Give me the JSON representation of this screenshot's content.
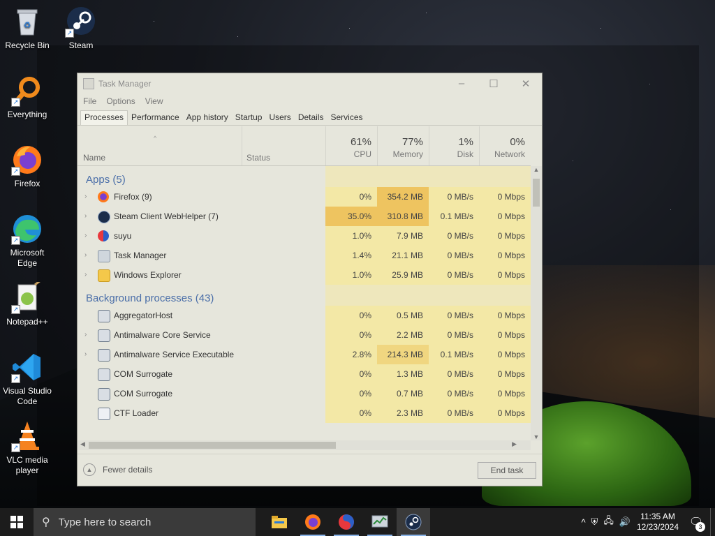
{
  "desktop": {
    "icons": [
      {
        "label": "Recycle Bin",
        "icon": "recycle-bin-icon"
      },
      {
        "label": "Steam",
        "icon": "steam-icon"
      },
      {
        "label": "Everything",
        "icon": "everything-icon"
      },
      {
        "label": "Firefox",
        "icon": "firefox-icon"
      },
      {
        "label": "Microsoft Edge",
        "icon": "edge-icon"
      },
      {
        "label": "Notepad++",
        "icon": "notepadpp-icon"
      },
      {
        "label": "Visual Studio Code",
        "icon": "vscode-icon"
      },
      {
        "label": "VLC media player",
        "icon": "vlc-icon"
      }
    ]
  },
  "task_manager": {
    "title": "Task Manager",
    "menu": [
      "File",
      "Options",
      "View"
    ],
    "tabs": [
      "Processes",
      "Performance",
      "App history",
      "Startup",
      "Users",
      "Details",
      "Services"
    ],
    "active_tab": "Processes",
    "columns": {
      "name": "Name",
      "status": "Status",
      "cpu": {
        "pct": "61%",
        "label": "CPU"
      },
      "memory": {
        "pct": "77%",
        "label": "Memory"
      },
      "disk": {
        "pct": "1%",
        "label": "Disk"
      },
      "network": {
        "pct": "0%",
        "label": "Network"
      }
    },
    "groups": [
      {
        "title": "Apps (5)",
        "rows": [
          {
            "name": "Firefox (9)",
            "cpu": "0%",
            "memory": "354.2 MB",
            "disk": "0 MB/s",
            "network": "0 Mbps",
            "expandable": true,
            "icon": "firefox-icon"
          },
          {
            "name": "Steam Client WebHelper (7)",
            "cpu": "35.0%",
            "memory": "310.8 MB",
            "disk": "0.1 MB/s",
            "network": "0 Mbps",
            "expandable": true,
            "icon": "steam-icon"
          },
          {
            "name": "suyu",
            "cpu": "1.0%",
            "memory": "7.9 MB",
            "disk": "0 MB/s",
            "network": "0 Mbps",
            "expandable": true,
            "icon": "suyu-icon"
          },
          {
            "name": "Task Manager",
            "cpu": "1.4%",
            "memory": "21.1 MB",
            "disk": "0 MB/s",
            "network": "0 Mbps",
            "expandable": true,
            "icon": "task-manager-icon"
          },
          {
            "name": "Windows Explorer",
            "cpu": "1.0%",
            "memory": "25.9 MB",
            "disk": "0 MB/s",
            "network": "0 Mbps",
            "expandable": true,
            "icon": "explorer-icon"
          }
        ]
      },
      {
        "title": "Background processes (43)",
        "rows": [
          {
            "name": "AggregatorHost",
            "cpu": "0%",
            "memory": "0.5 MB",
            "disk": "0 MB/s",
            "network": "0 Mbps",
            "expandable": false,
            "icon": "service-icon"
          },
          {
            "name": "Antimalware Core Service",
            "cpu": "0%",
            "memory": "2.2 MB",
            "disk": "0 MB/s",
            "network": "0 Mbps",
            "expandable": true,
            "icon": "service-icon"
          },
          {
            "name": "Antimalware Service Executable",
            "cpu": "2.8%",
            "memory": "214.3 MB",
            "disk": "0.1 MB/s",
            "network": "0 Mbps",
            "expandable": true,
            "icon": "service-icon"
          },
          {
            "name": "COM Surrogate",
            "cpu": "0%",
            "memory": "1.3 MB",
            "disk": "0 MB/s",
            "network": "0 Mbps",
            "expandable": false,
            "icon": "service-icon"
          },
          {
            "name": "COM Surrogate",
            "cpu": "0%",
            "memory": "0.7 MB",
            "disk": "0 MB/s",
            "network": "0 Mbps",
            "expandable": false,
            "icon": "service-icon"
          },
          {
            "name": "CTF Loader",
            "cpu": "0%",
            "memory": "2.3 MB",
            "disk": "0 MB/s",
            "network": "0 Mbps",
            "expandable": false,
            "icon": "ctf-icon"
          }
        ]
      }
    ],
    "fewer_details": "Fewer details",
    "end_task": "End task"
  },
  "taskbar": {
    "search_placeholder": "Type here to search",
    "apps": [
      "file-explorer-icon",
      "firefox-icon",
      "suyu-icon",
      "task-manager-icon",
      "steam-icon"
    ],
    "active_app": "steam-icon",
    "time": "11:35 AM",
    "date": "12/23/2024",
    "notification_count": "3"
  },
  "colors": {
    "heat_light": "#f3e8a6",
    "heat_mid": "#f0d680",
    "heat_strong": "#eec460",
    "group_title": "#4a6ea8"
  }
}
